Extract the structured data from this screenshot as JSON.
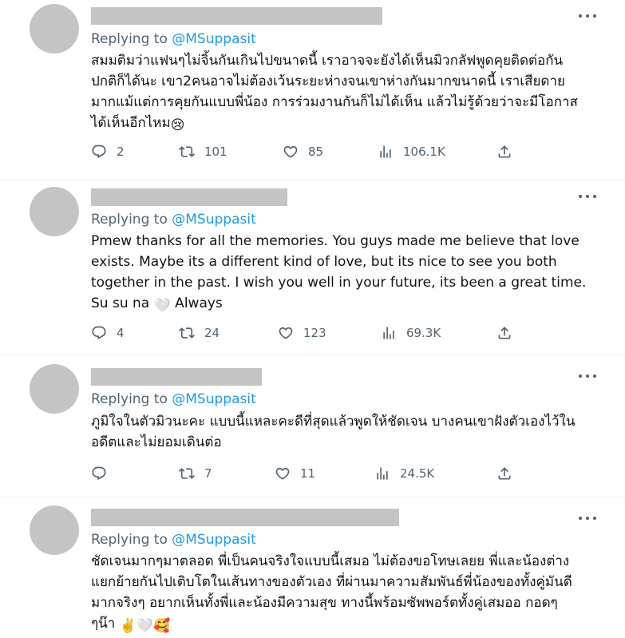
{
  "tweets": [
    {
      "replying_prefix": "Replying to ",
      "replying_handle": "@MSuppasit",
      "text": "สมมติมว่าแฟนๆไม่จิ้นกันเกินไปขนาดนี้ เราอาจจะยังได้เห็นมิวกลัฟพูดคุยติดต่อกัน\nปกติก็ได้นะ เขา2คนอาจไม่ต้องเว้นระยะห่างจนเขาห่างกันมากขนาดนี้ เราเสียดาย\nมากแม้แต่การคุยกันแบบพี่น้อง การร่วมงานกันก็ไม่ได้เห็น แล้วไม่รู้ด้วยว่าจะมีโอกาส\nได้เห็นอีกไหม",
      "emoji": "😢",
      "replies": "2",
      "retweets": "101",
      "likes": "85",
      "views": "106.1K"
    },
    {
      "replying_prefix": "Replying to ",
      "replying_handle": "@MSuppasit",
      "text": "Pmew thanks for all the memories. You guys made me believe that love\nexists. Maybe its a different kind of love, but its nice to see you both\ntogether in the past. I wish you well in your future, its been a great time.\nSu su na ",
      "emoji": "🤍",
      "text_after": " Always",
      "replies": "4",
      "retweets": "24",
      "likes": "123",
      "views": "69.3K"
    },
    {
      "replying_prefix": "Replying to ",
      "replying_handle": "@MSuppasit",
      "text": "ภูมิใจในตัวมิวนะคะ แบบนี้แหละคะดีที่สุดแล้วพูดให้ชัดเจน บางคนเขาฝังตัวเองไว้ใน\nอดีตและไม่ยอมเดินต่อ",
      "replies": "",
      "retweets": "7",
      "likes": "11",
      "views": "24.5K"
    },
    {
      "replying_prefix": "Replying to ",
      "replying_handle": "@MSuppasit",
      "text": "ชัดเจนมากๆมาตลอด พี่เป็นคนจริงใจแบบนี้เสมอ ไม่ต้องขอโทษเลยย พี่และน้องต่าง\nแยกย้ายกันไปเติบโตในเส้นทางของตัวเอง ที่ผ่านมาความสัมพันธ์พี่น้องของทั้งคู่มันดี\nมากจริงๆ อยากเห็นทั้งพี่และน้องมีความสุข ทางนี้พร้อมซัพพอร์ตทั้งคู่เสมออ กอดๆ\nๆน๊า ",
      "emoji": "✌️🤍🥰"
    }
  ],
  "colors": {
    "handle": "#1d9bf0",
    "muted": "#536471",
    "text": "#0f1419",
    "placeholder": "#c4c4c4"
  },
  "icons": [
    "reply-icon",
    "retweet-icon",
    "like-icon",
    "views-icon",
    "share-icon",
    "more-icon"
  ]
}
